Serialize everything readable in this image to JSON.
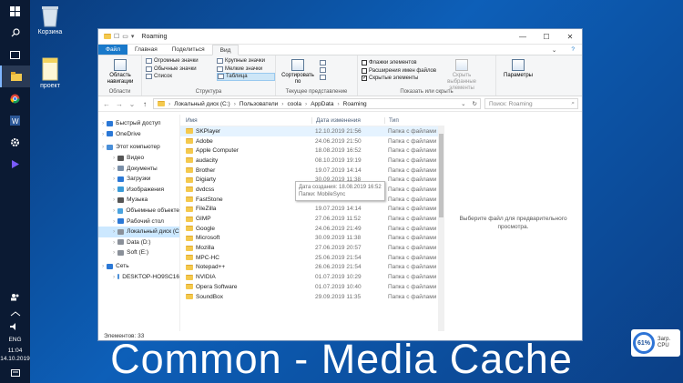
{
  "desktop": {
    "icons": [
      {
        "label": "Корзина"
      },
      {
        "label": "проект"
      }
    ]
  },
  "taskbar": {
    "time": "11:04",
    "date": "14.10.2019",
    "lang": "ENG"
  },
  "window": {
    "title": "Roaming",
    "tabs": [
      "Файл",
      "Главная",
      "Поделиться",
      "Вид"
    ],
    "ribbon": {
      "panels_group": {
        "button": "Область навигации",
        "name": "Области"
      },
      "layout_items": [
        "Огромные значки",
        "Крупные значки",
        "Обычные значки",
        "Мелкие значки",
        "Список",
        "Таблица"
      ],
      "layout_group_name": "Структура",
      "sort_button": "Сортировать по",
      "current_view_group_name": "Текущее представление",
      "checkboxes": [
        {
          "label": "Флажки элементов",
          "checked": false
        },
        {
          "label": "Расширения имен файлов",
          "checked": false
        },
        {
          "label": "Скрытые элементы",
          "checked": true
        }
      ],
      "hide_selected": "Скрыть выбранные элементы",
      "show_hide_group_name": "Показать или скрыть",
      "options_button": "Параметры"
    },
    "address": {
      "segments": [
        "Локальный диск (C:)",
        "Пользователи",
        "coola",
        "AppData",
        "Roaming"
      ],
      "search_placeholder": "Поиск: Roaming"
    },
    "nav_pane": [
      {
        "label": "Быстрый доступ",
        "icon": "star-icon",
        "level": 0
      },
      {
        "label": "OneDrive",
        "icon": "cloud-icon",
        "level": 0
      },
      {
        "label": "Этот компьютер",
        "icon": "computer-icon",
        "level": 0
      },
      {
        "label": "Видео",
        "icon": "video-icon",
        "level": 1
      },
      {
        "label": "Документы",
        "icon": "documents-icon",
        "level": 1
      },
      {
        "label": "Загрузки",
        "icon": "downloads-icon",
        "level": 1
      },
      {
        "label": "Изображения",
        "icon": "pictures-icon",
        "level": 1
      },
      {
        "label": "Музыка",
        "icon": "music-icon",
        "level": 1
      },
      {
        "label": "Объемные объекте",
        "icon": "3d-objects-icon",
        "level": 1
      },
      {
        "label": "Рабочий стол",
        "icon": "desktop-icon",
        "level": 1
      },
      {
        "label": "Локальный диск (C",
        "icon": "drive-icon",
        "level": 1,
        "selected": true
      },
      {
        "label": "Data (D:)",
        "icon": "drive-icon",
        "level": 1
      },
      {
        "label": "Soft (E:)",
        "icon": "drive-icon",
        "level": 1
      },
      {
        "label": "Сеть",
        "icon": "network-icon",
        "level": 0
      },
      {
        "label": "DESKTOP-HO9SC16",
        "icon": "computer-icon",
        "level": 1
      }
    ],
    "columns": {
      "name": "Имя",
      "date": "Дата изменения",
      "type": "Тип"
    },
    "files": [
      {
        "name": "SKPlayer",
        "date": "12.10.2019 21:56",
        "type": "Папка с файлами"
      },
      {
        "name": "Adobe",
        "date": "24.06.2019 21:50",
        "type": "Папка с файлами"
      },
      {
        "name": "Apple Computer",
        "date": "18.08.2019 16:52",
        "type": "Папка с файлами"
      },
      {
        "name": "audacity",
        "date": "08.10.2019 19:19",
        "type": "Папка с файлами"
      },
      {
        "name": "Brother",
        "date": "19.07.2019 14:14",
        "type": "Папка с файлами"
      },
      {
        "name": "Digiarty",
        "date": "30.09.2019 11:38",
        "type": "Папка с файлами"
      },
      {
        "name": "dvdcss",
        "date": "30.06.2019 11:24",
        "type": "Папка с файлами"
      },
      {
        "name": "FastStone",
        "date": "27.06.2019 11:54",
        "type": "Папка с файлами"
      },
      {
        "name": "FileZilla",
        "date": "19.07.2019 14:14",
        "type": "Папка с файлами"
      },
      {
        "name": "GIMP",
        "date": "27.06.2019 11:52",
        "type": "Папка с файлами"
      },
      {
        "name": "Google",
        "date": "24.06.2019 21:49",
        "type": "Папка с файлами"
      },
      {
        "name": "Microsoft",
        "date": "30.09.2019 11:38",
        "type": "Папка с файлами"
      },
      {
        "name": "Mozilla",
        "date": "27.06.2019 20:57",
        "type": "Папка с файлами"
      },
      {
        "name": "MPC-HC",
        "date": "25.06.2019 21:54",
        "type": "Папка с файлами"
      },
      {
        "name": "Notepad++",
        "date": "26.06.2019 21:54",
        "type": "Папка с файлами"
      },
      {
        "name": "NVIDIA",
        "date": "01.07.2019 10:29",
        "type": "Папка с файлами"
      },
      {
        "name": "Opera Software",
        "date": "01.07.2019 10:40",
        "type": "Папка с файлами"
      },
      {
        "name": "SoundBox",
        "date": "29.09.2019 11:35",
        "type": "Папка с файлами"
      }
    ],
    "tooltip": {
      "line1": "Дата создания: 18.08.2019 16:52",
      "line2": "Папки: MobileSync"
    },
    "preview_text": "Выберите файл для предварительного просмотра.",
    "status": "Элементов: 33"
  },
  "caption": "Common - Media Cache",
  "cpu_widget": {
    "percent": "61%",
    "label1": "Загр.",
    "label2": "CPU"
  },
  "colors": {
    "file_tab": "#1979ca",
    "selection": "#cce8ff",
    "folder": "#f4c94e"
  }
}
